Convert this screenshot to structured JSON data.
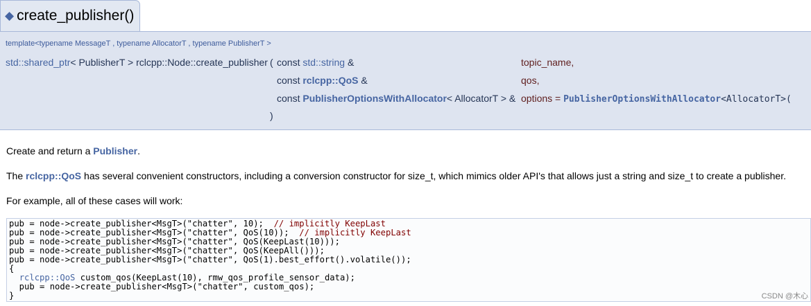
{
  "member": {
    "title": "create_publisher()"
  },
  "prototype": {
    "template_line": "template<typename MessageT , typename AllocatorT , typename PublisherT >",
    "return_type": "std::shared_ptr",
    "return_tail": "< PublisherT > rclcpp::Node::create_publisher",
    "open_paren": "(",
    "close_paren": ")",
    "params": [
      {
        "prefix": "const ",
        "type": "std::string",
        "suffix": " &",
        "name": "topic_name,"
      },
      {
        "prefix": "const ",
        "type": "rclcpp::QoS",
        "suffix": " &",
        "name": "qos,"
      },
      {
        "prefix": "const ",
        "type": "PublisherOptionsWithAllocator",
        "suffix": "< AllocatorT > &",
        "name": "options = ",
        "default_type": "PublisherOptionsWithAllocator",
        "default_tail": "<AllocatorT>("
      }
    ]
  },
  "description": {
    "line1_prefix": "Create and return a ",
    "line1_link": "Publisher",
    "line1_suffix": ".",
    "line2_prefix": "The ",
    "line2_link": "rclcpp::QoS",
    "line2_suffix": " has several convenient constructors, including a conversion constructor for size_t, which mimics older API's that allows just a string and size_t to create a publisher.",
    "line3": "For example, all of these cases will work:"
  },
  "code": {
    "lines": [
      {
        "code": "pub = node->create_publisher<MsgT>(\"chatter\", 10);  ",
        "comment": "// implicitly KeepLast"
      },
      {
        "code": "pub = node->create_publisher<MsgT>(\"chatter\", QoS(10));  ",
        "comment": "// implicitly KeepLast"
      },
      {
        "code": "pub = node->create_publisher<MsgT>(\"chatter\", QoS(KeepLast(10)));",
        "comment": ""
      },
      {
        "code": "pub = node->create_publisher<MsgT>(\"chatter\", QoS(KeepAll()));",
        "comment": ""
      },
      {
        "code": "pub = node->create_publisher<MsgT>(\"chatter\", QoS(1).best_effort().volatile());",
        "comment": ""
      },
      {
        "code": "{",
        "comment": ""
      },
      {
        "indent": "  ",
        "ns": "rclcpp::QoS",
        "code": " custom_qos(KeepLast(10), rmw_qos_profile_sensor_data);",
        "comment": ""
      },
      {
        "code": "  pub = node->create_publisher<MsgT>(\"chatter\", custom_qos);",
        "comment": ""
      },
      {
        "code": "}",
        "comment": ""
      }
    ]
  },
  "watermark": "CSDN @木心"
}
